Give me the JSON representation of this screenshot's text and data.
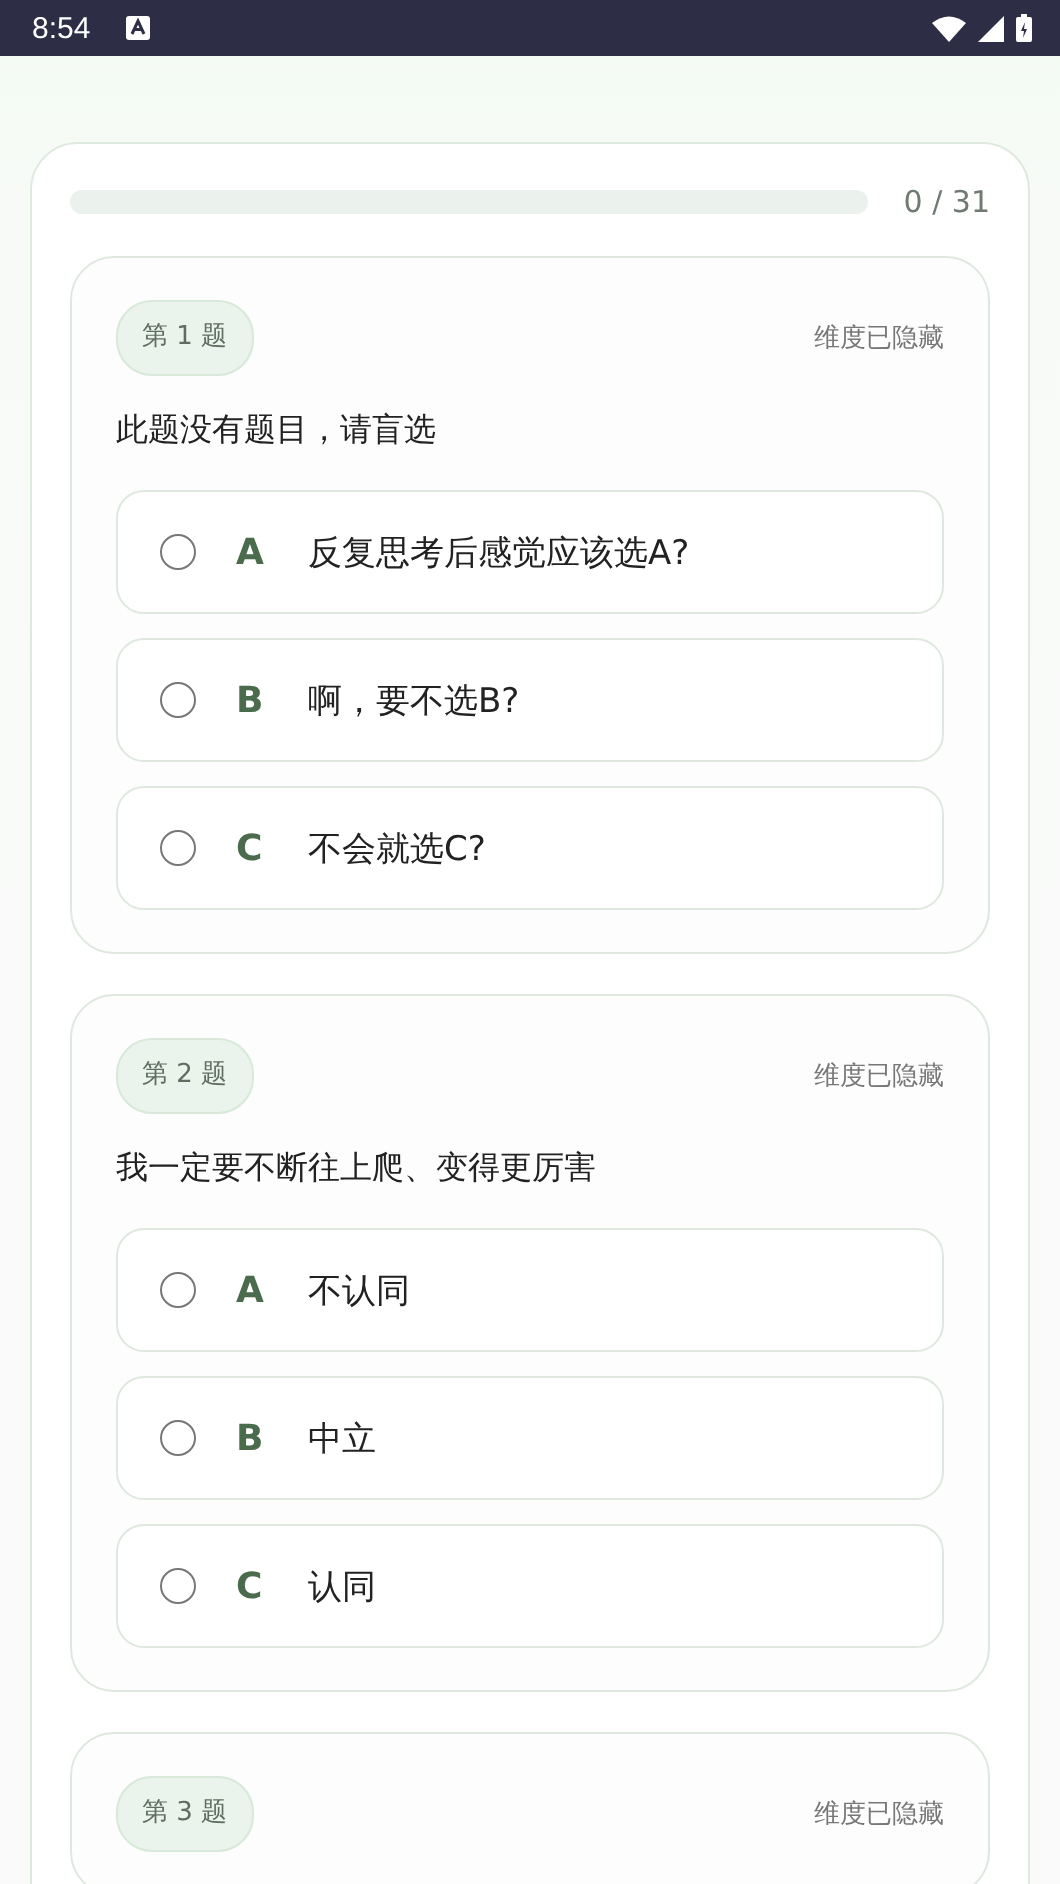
{
  "status_bar": {
    "time": "8:54"
  },
  "progress": {
    "level": 0,
    "count": "0 / 31"
  },
  "questions": [
    {
      "number": "第 1 题",
      "note": "维度已隐藏",
      "text": "此题没有题目，请盲选",
      "options": [
        {
          "letter": "A",
          "label": "反复思考后感觉应该选A?",
          "selected": false
        },
        {
          "letter": "B",
          "label": "啊，要不选B?",
          "selected": false
        },
        {
          "letter": "C",
          "label": "不会就选C?",
          "selected": false
        }
      ]
    },
    {
      "number": "第 2 题",
      "note": "维度已隐藏",
      "text": "我一定要不断往上爬、变得更厉害",
      "options": [
        {
          "letter": "A",
          "label": "不认同",
          "selected": false
        },
        {
          "letter": "B",
          "label": "中立",
          "selected": false
        },
        {
          "letter": "C",
          "label": "认同",
          "selected": false
        }
      ]
    },
    {
      "number": "第 3 题",
      "note": "维度已隐藏"
    }
  ]
}
